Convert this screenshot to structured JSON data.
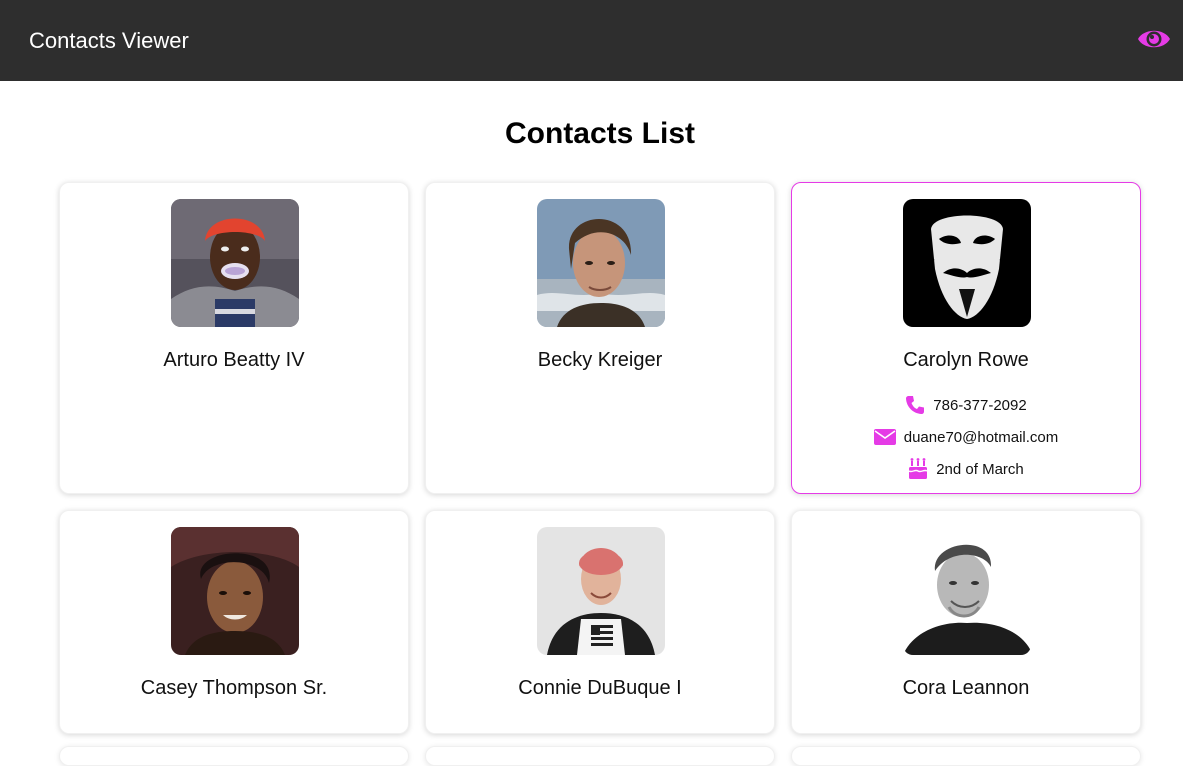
{
  "app": {
    "title": "Contacts Viewer",
    "toggle_icon": "eye-icon"
  },
  "page": {
    "title": "Contacts List"
  },
  "accent_color": "#e53be6",
  "contacts": [
    {
      "name": "Arturo Beatty IV"
    },
    {
      "name": "Becky Kreiger"
    },
    {
      "name": "Carolyn Rowe",
      "phone": "786-377-2092",
      "email": "duane70@hotmail.com",
      "birthday": "2nd of March",
      "selected": true
    },
    {
      "name": "Casey Thompson Sr."
    },
    {
      "name": "Connie DuBuque I"
    },
    {
      "name": "Cora Leannon"
    }
  ]
}
